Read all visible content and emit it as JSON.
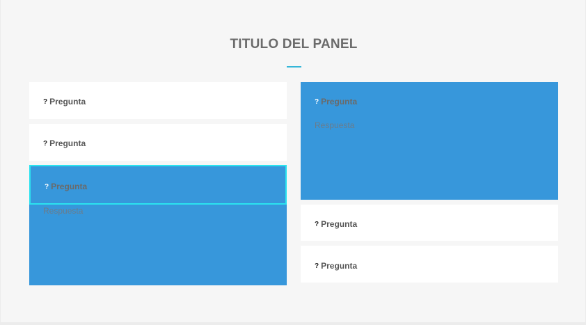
{
  "panel": {
    "title": "TITULO DEL PANEL"
  },
  "left_column": [
    {
      "question": "Pregunta",
      "expanded": false
    },
    {
      "question": "Pregunta",
      "expanded": false
    },
    {
      "question": "Pregunta",
      "expanded": true,
      "focused": true,
      "answer": "Respuesta"
    }
  ],
  "right_column": [
    {
      "question": "Pregunta",
      "expanded": true,
      "answer": "Respuesta"
    },
    {
      "question": "Pregunta",
      "expanded": false
    },
    {
      "question": "Pregunta",
      "expanded": false
    }
  ],
  "icons": {
    "question": "question-mark-icon",
    "question_glyph": "?"
  },
  "colors": {
    "accent": "#35b6d8",
    "expanded_bg": "#3797db",
    "focus_border": "#2be3ef",
    "collapsed_bg": "#ffffff",
    "page_bg": "#f6f6f6"
  }
}
